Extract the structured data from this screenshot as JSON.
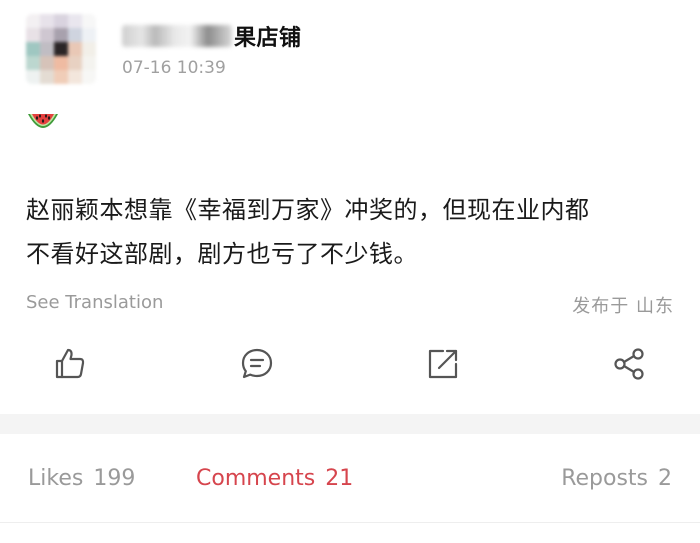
{
  "post": {
    "author_suffix": "果店铺",
    "timestamp": "07-16 10:39",
    "emoji": "watermelon-icon",
    "text_line1": "赵丽颖本想靠《幸福到万家》冲奖的，但现在业内都",
    "text_line2": "不看好这部剧，剧方也亏了不少钱。",
    "see_translation": "See Translation",
    "location": "发布于 山东"
  },
  "actions": [
    {
      "icon": "thumbs-up-icon"
    },
    {
      "icon": "comment-icon"
    },
    {
      "icon": "repost-icon"
    },
    {
      "icon": "share-icon"
    }
  ],
  "tabs": {
    "likes": {
      "label": "Likes",
      "count": "199"
    },
    "comments": {
      "label": "Comments",
      "count": "21"
    },
    "reposts": {
      "label": "Reposts",
      "count": "2"
    }
  },
  "colors": {
    "accent": "#d6454d",
    "muted_text": "#9a9a9a",
    "icon_stroke": "#555555"
  }
}
